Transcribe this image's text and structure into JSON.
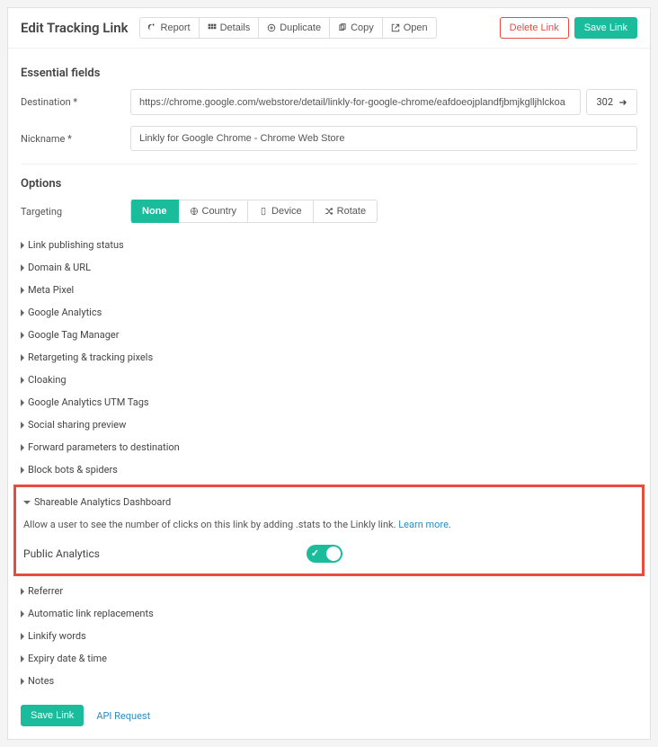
{
  "header": {
    "title": "Edit Tracking Link",
    "buttons": {
      "report": "Report",
      "details": "Details",
      "duplicate": "Duplicate",
      "copy": "Copy",
      "open": "Open"
    },
    "delete": "Delete Link",
    "save": "Save Link"
  },
  "essential": {
    "title": "Essential fields",
    "destination_label": "Destination *",
    "destination_value": "https://chrome.google.com/webstore/detail/linkly-for-google-chrome/eafdoeojplandfjbmjkglljhlckoa",
    "redirect_code": "302",
    "nickname_label": "Nickname *",
    "nickname_value": "Linkly for Google Chrome - Chrome Web Store"
  },
  "options": {
    "title": "Options",
    "targeting_label": "Targeting",
    "tabs": {
      "none": "None",
      "country": "Country",
      "device": "Device",
      "rotate": "Rotate"
    }
  },
  "collapses": {
    "link_publishing": "Link publishing status",
    "domain_url": "Domain & URL",
    "meta_pixel": "Meta Pixel",
    "ga": "Google Analytics",
    "gtm": "Google Tag Manager",
    "retargeting": "Retargeting & tracking pixels",
    "cloaking": "Cloaking",
    "utm": "Google Analytics UTM Tags",
    "social": "Social sharing preview",
    "forward": "Forward parameters to destination",
    "bots": "Block bots & spiders",
    "shareable": "Shareable Analytics Dashboard",
    "referrer": "Referrer",
    "auto_replace": "Automatic link replacements",
    "linkify": "Linkify words",
    "expiry": "Expiry date & time",
    "notes": "Notes"
  },
  "shareable": {
    "desc_1": "Allow a user to see the number of clicks on this link by adding .stats to the Linkly link. ",
    "learn_more": "Learn more",
    "public_label": "Public Analytics"
  },
  "footer": {
    "save": "Save Link",
    "api": "API Request"
  }
}
